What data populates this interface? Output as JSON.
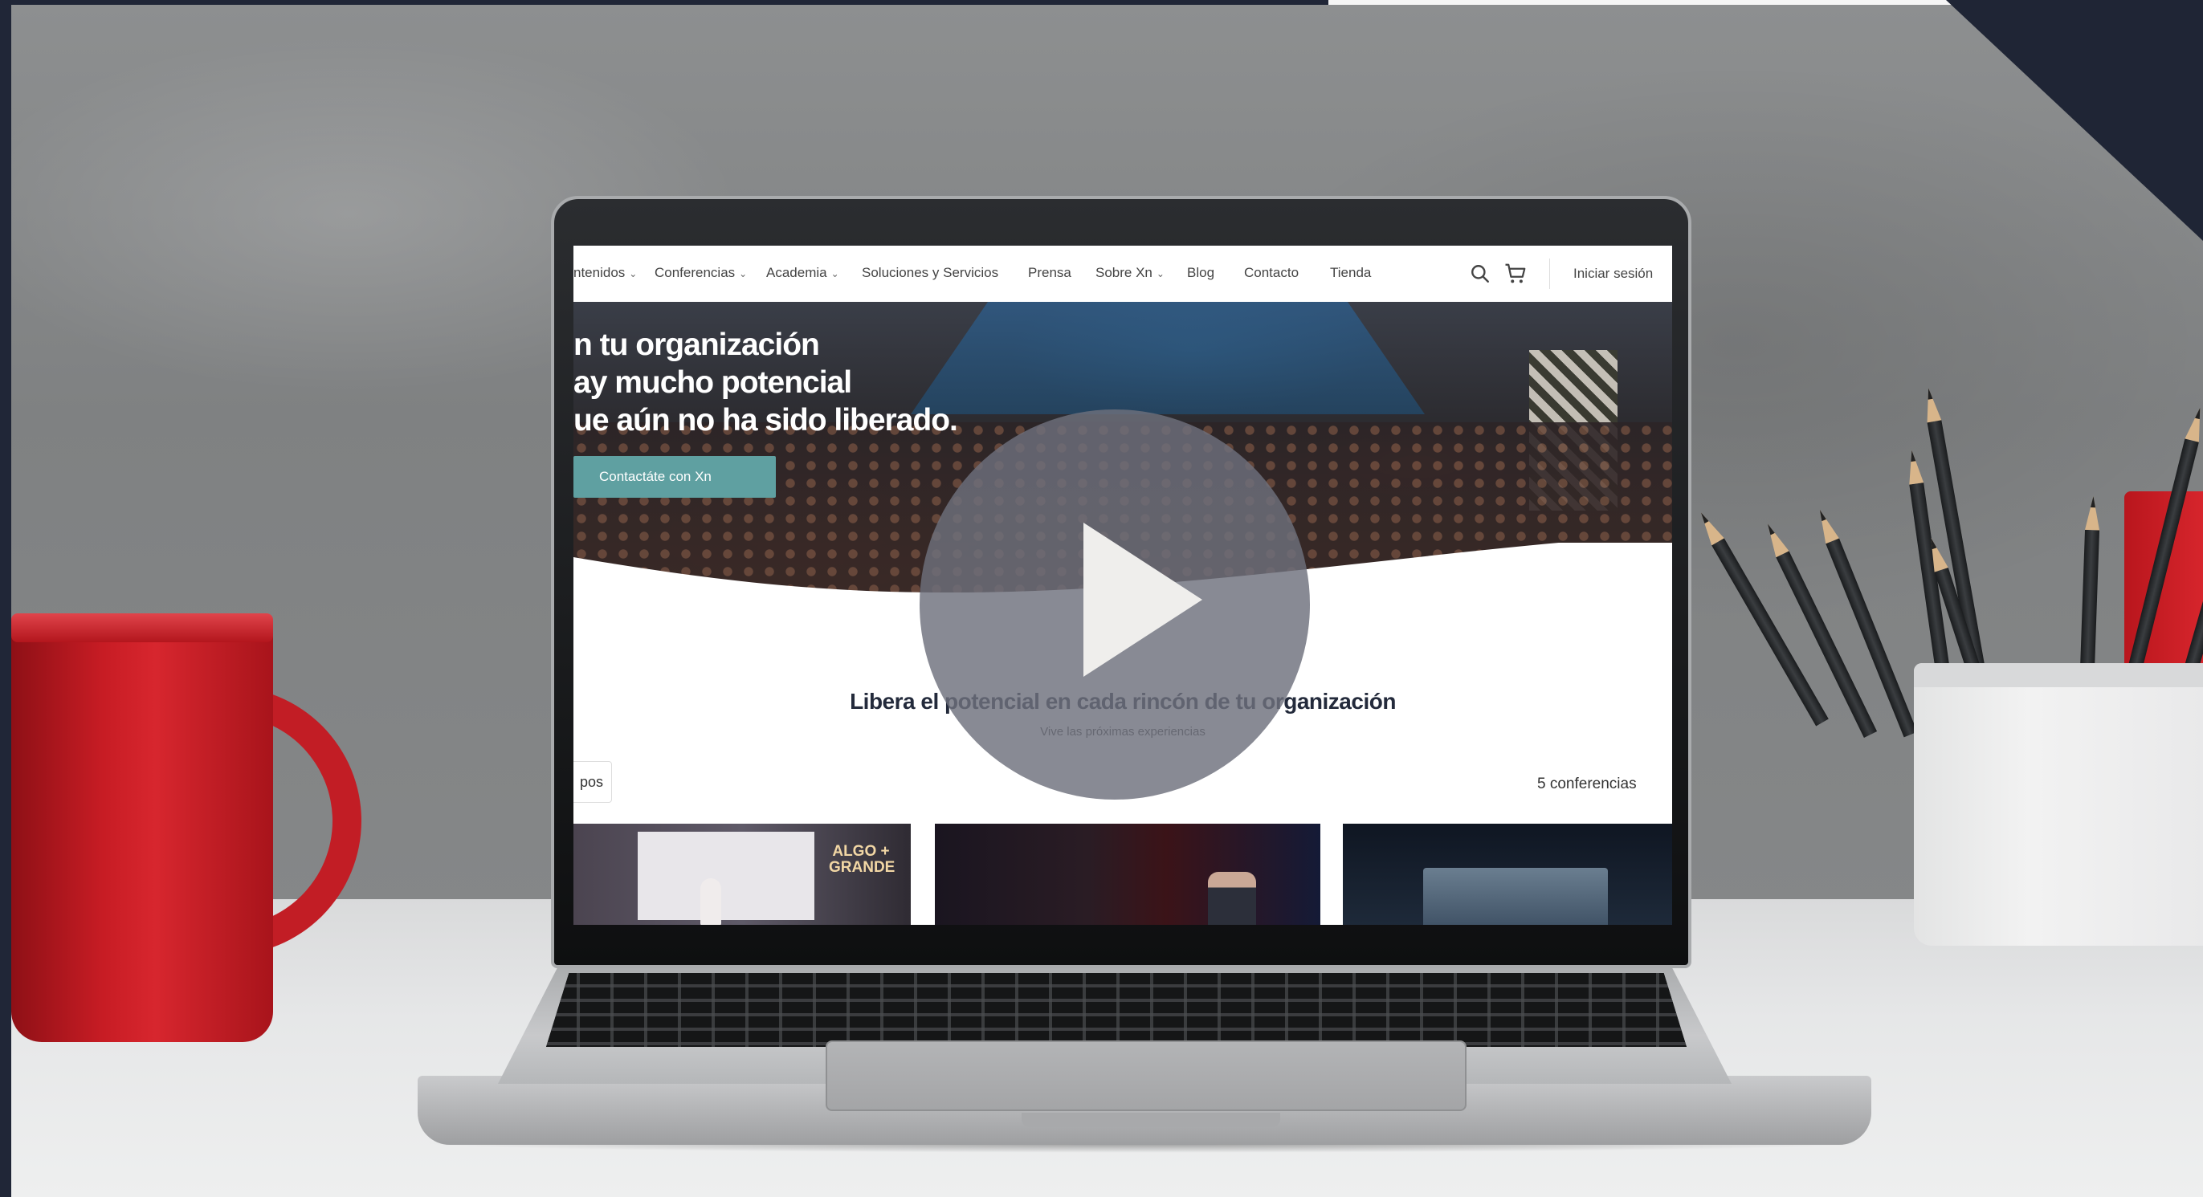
{
  "nav": {
    "items": [
      {
        "label": "ntenidos",
        "has_dropdown": true
      },
      {
        "label": "Conferencias",
        "has_dropdown": true
      },
      {
        "label": "Academia",
        "has_dropdown": true
      },
      {
        "label": "Soluciones y Servicios",
        "has_dropdown": false
      },
      {
        "label": "Prensa",
        "has_dropdown": false
      },
      {
        "label": "Sobre Xn",
        "has_dropdown": true
      },
      {
        "label": "Blog",
        "has_dropdown": false
      },
      {
        "label": "Contacto",
        "has_dropdown": false
      },
      {
        "label": "Tienda",
        "has_dropdown": false
      }
    ],
    "search_icon": "search-icon",
    "cart_icon": "cart-icon",
    "login_label": "Iniciar sesión"
  },
  "hero": {
    "headline_lines": [
      "n tu organización",
      "ay mucho potencial",
      "ue aún no ha sido liberado."
    ],
    "cta_label": "Contactáte con Xn"
  },
  "section": {
    "title": "Libera el potencial en cada rincón de tu organización",
    "subtitle": "Vive las próximas experiencias",
    "filter_label": "pos",
    "count_label": "5 conferencias"
  },
  "cards": [
    {
      "slide_text": "ALGO + GRANDE"
    },
    {},
    {}
  ],
  "play_button": {
    "icon": "play-icon"
  },
  "colors": {
    "cta": "#5fa0a1",
    "heading": "#232a3b",
    "frame": "#1f2535",
    "play_overlay": "#6e707d"
  }
}
